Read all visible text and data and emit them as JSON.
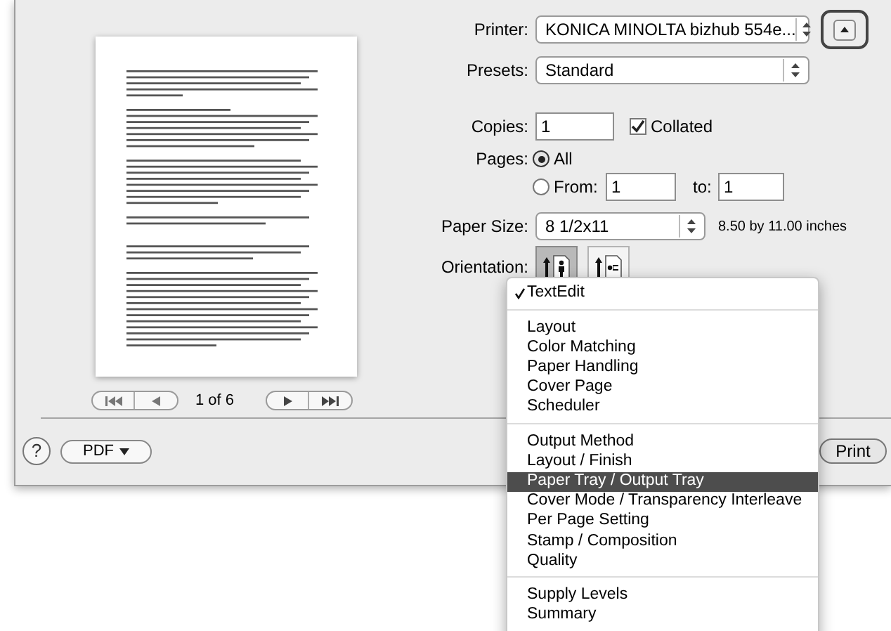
{
  "printer": {
    "label": "Printer:",
    "value": "KONICA MINOLTA bizhub 554e..."
  },
  "presets": {
    "label": "Presets:",
    "value": "Standard"
  },
  "copies": {
    "label": "Copies:",
    "value": "1",
    "collated": {
      "label": "Collated",
      "checked": true
    }
  },
  "pages": {
    "label": "Pages:",
    "options": [
      {
        "label": "All",
        "selected": true
      },
      {
        "label": "From:",
        "selected": false
      }
    ],
    "from": "1",
    "to_label": "to:",
    "to": "1"
  },
  "paper_size": {
    "label": "Paper Size:",
    "value": "8 1/2x11",
    "dimensions": "8.50 by 11.00 inches"
  },
  "orientation": {
    "label": "Orientation:",
    "options": [
      {
        "kind": "portrait",
        "selected": true
      },
      {
        "kind": "landscape",
        "selected": false
      }
    ]
  },
  "preview": {
    "page_indicator": "1 of 6"
  },
  "help_button": "?",
  "pdf_button": "PDF",
  "print_button": "Print",
  "menu": {
    "groups": [
      [
        {
          "label": "TextEdit",
          "checked": true,
          "selected": false
        }
      ],
      [
        {
          "label": "Layout",
          "checked": false,
          "selected": false
        },
        {
          "label": "Color Matching",
          "checked": false,
          "selected": false
        },
        {
          "label": "Paper Handling",
          "checked": false,
          "selected": false
        },
        {
          "label": "Cover Page",
          "checked": false,
          "selected": false
        },
        {
          "label": "Scheduler",
          "checked": false,
          "selected": false
        }
      ],
      [
        {
          "label": "Output Method",
          "checked": false,
          "selected": false
        },
        {
          "label": "Layout / Finish",
          "checked": false,
          "selected": false
        },
        {
          "label": "Paper Tray / Output Tray",
          "checked": false,
          "selected": true
        },
        {
          "label": "Cover Mode / Transparency Interleave",
          "checked": false,
          "selected": false
        },
        {
          "label": "Per Page Setting",
          "checked": false,
          "selected": false
        },
        {
          "label": "Stamp / Composition",
          "checked": false,
          "selected": false
        },
        {
          "label": "Quality",
          "checked": false,
          "selected": false
        }
      ],
      [
        {
          "label": "Supply Levels",
          "checked": false,
          "selected": false
        },
        {
          "label": "Summary",
          "checked": false,
          "selected": false
        }
      ]
    ]
  }
}
